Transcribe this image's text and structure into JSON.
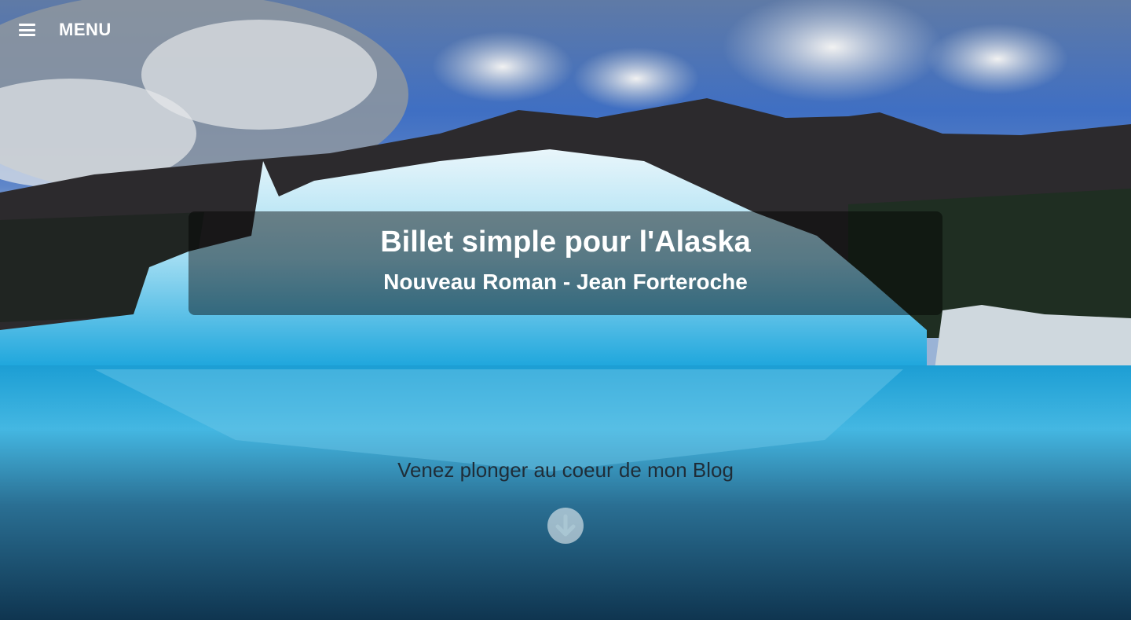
{
  "header": {
    "menu_label": "MENU",
    "menu_icon": "hamburger-icon"
  },
  "hero": {
    "title": "Billet simple pour l'Alaska",
    "subtitle": "Nouveau Roman - Jean Forteroche",
    "tagline": "Venez plonger au coeur de mon Blog",
    "scroll_icon": "arrow-down-circle-icon"
  },
  "colors": {
    "overlay": "#000000",
    "text": "#ffffff",
    "tagline": "#1f2d38",
    "water": "#1aa3d6"
  }
}
